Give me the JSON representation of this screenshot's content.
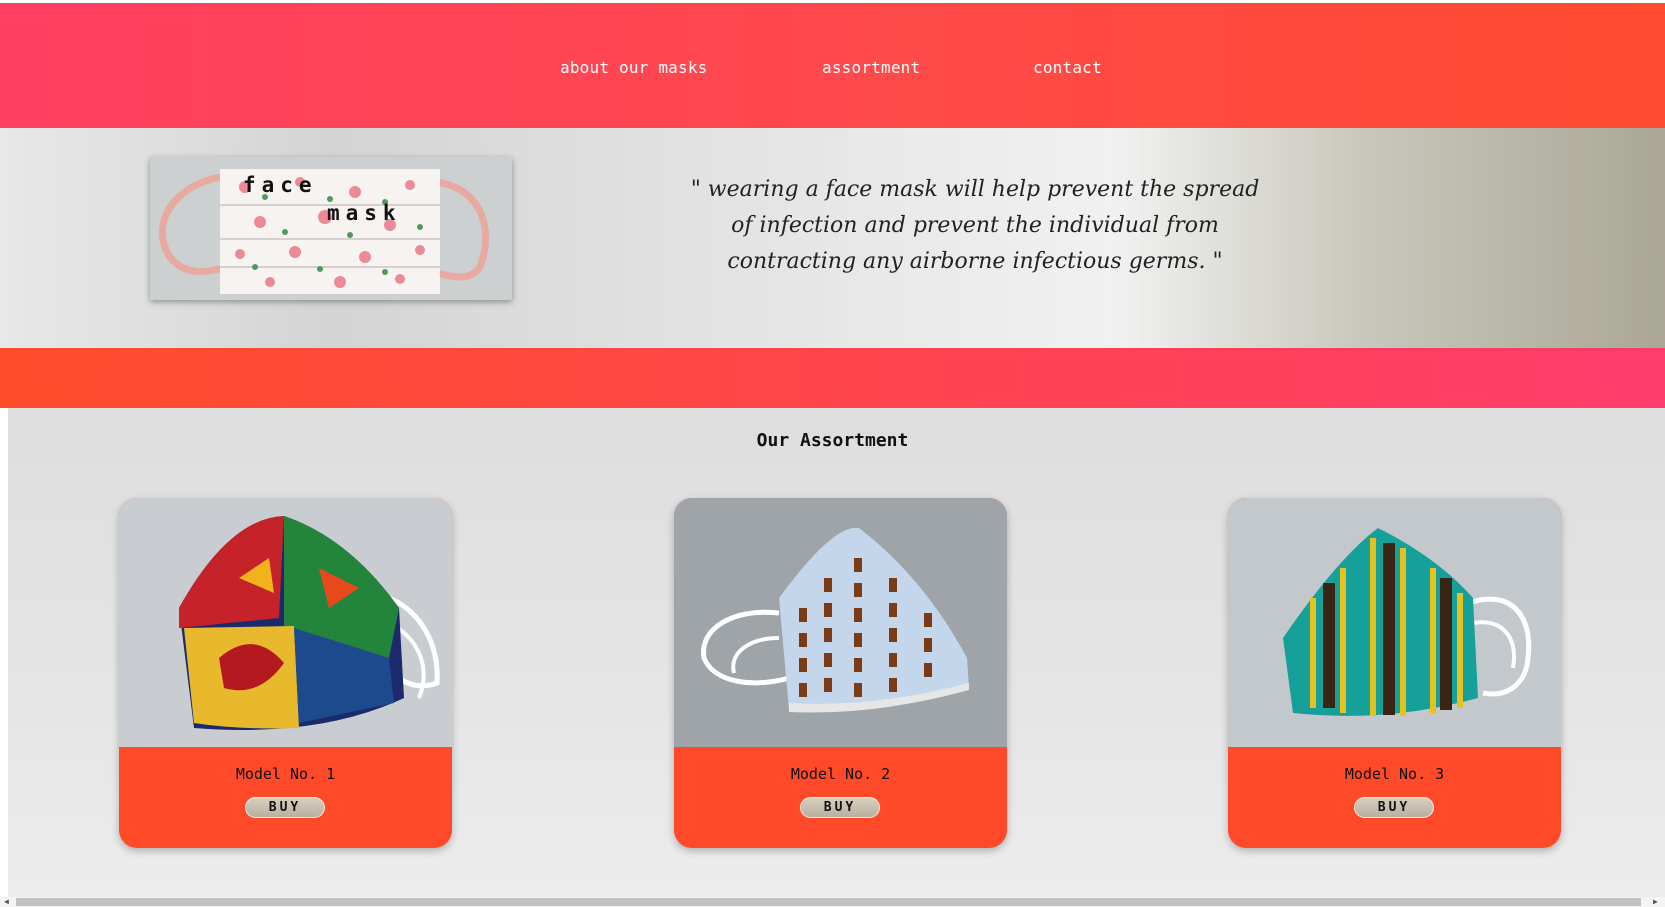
{
  "nav": {
    "links": [
      "about our masks",
      "assortment",
      "contact"
    ]
  },
  "hero": {
    "image_words": [
      "face",
      "mask"
    ],
    "quote": "\" wearing a face mask will help prevent the spread of infection and prevent the individual from contracting any airborne infectious germs. \""
  },
  "assortment": {
    "title": "Our Assortment",
    "products": [
      {
        "name": "Model No. 1",
        "buy_label": "BUY"
      },
      {
        "name": "Model No. 2",
        "buy_label": "BUY"
      },
      {
        "name": "Model No. 3",
        "buy_label": "BUY"
      }
    ]
  },
  "colors": {
    "nav_gradient_start": "#ff3f62",
    "nav_gradient_end": "#ff4c30",
    "card_footer": "#ff4a2a",
    "background": "#e4e4e4"
  },
  "icons": [
    "scroll-left-arrow-icon",
    "scroll-right-arrow-icon"
  ]
}
